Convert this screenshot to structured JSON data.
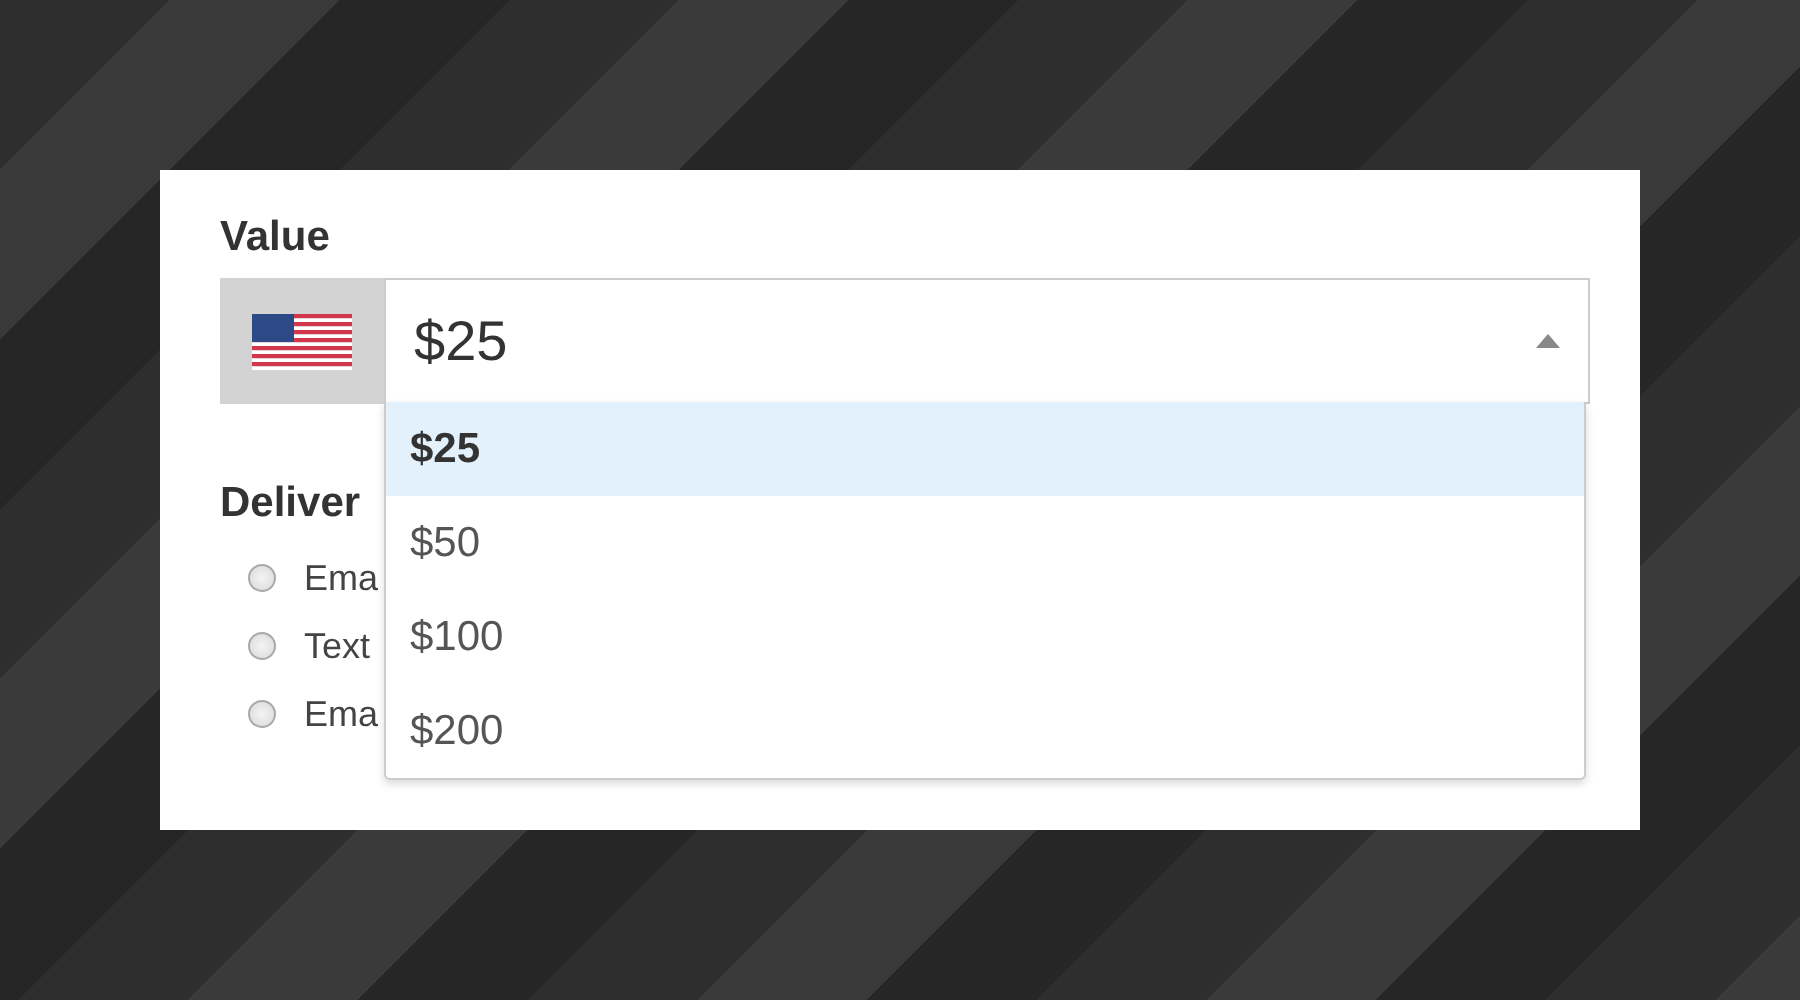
{
  "value_field": {
    "label": "Value",
    "selected_value": "$25",
    "expanded": true,
    "options": [
      {
        "label": "$25",
        "selected": true
      },
      {
        "label": "$50",
        "selected": false
      },
      {
        "label": "$100",
        "selected": false
      },
      {
        "label": "$200",
        "selected": false
      }
    ]
  },
  "delivery": {
    "heading": "Deliver",
    "options": [
      {
        "label": "Ema",
        "selected": false
      },
      {
        "label": "Text",
        "selected": false
      },
      {
        "label": "Ema",
        "selected": false
      }
    ]
  }
}
